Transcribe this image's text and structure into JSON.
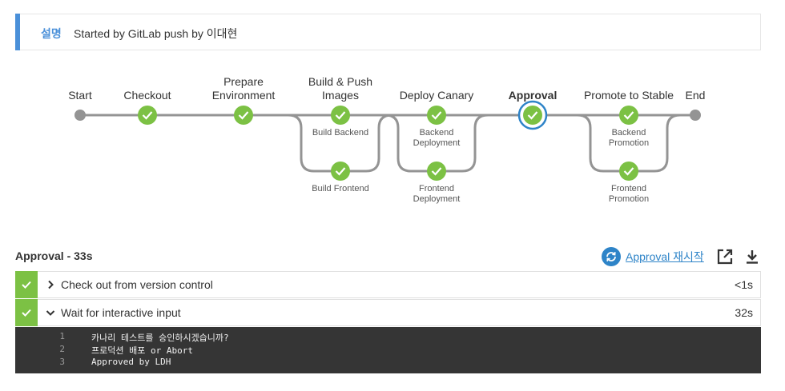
{
  "description": {
    "label": "설명",
    "text": "Started by GitLab push by 이대현"
  },
  "pipeline": {
    "stages": [
      {
        "id": "start",
        "title_lines": [
          "Start"
        ],
        "status": "endpoint"
      },
      {
        "id": "checkout",
        "title_lines": [
          "Checkout"
        ],
        "status": "success"
      },
      {
        "id": "prepare",
        "title_lines": [
          "Prepare",
          "Environment"
        ],
        "status": "success"
      },
      {
        "id": "build",
        "title_lines": [
          "Build & Push",
          "Images"
        ],
        "status": "success",
        "branches": [
          {
            "label_lines": [
              "Build Backend"
            ]
          },
          {
            "label_lines": [
              "Build Frontend"
            ]
          }
        ]
      },
      {
        "id": "deploy",
        "title_lines": [
          "Deploy Canary"
        ],
        "status": "success",
        "branches": [
          {
            "label_lines": [
              "Backend",
              "Deployment"
            ]
          },
          {
            "label_lines": [
              "Frontend",
              "Deployment"
            ]
          }
        ]
      },
      {
        "id": "approval",
        "title_lines": [
          "Approval"
        ],
        "status": "success",
        "selected": true
      },
      {
        "id": "promote",
        "title_lines": [
          "Promote to Stable"
        ],
        "status": "success",
        "branches": [
          {
            "label_lines": [
              "Backend",
              "Promotion"
            ]
          },
          {
            "label_lines": [
              "Frontend",
              "Promotion"
            ]
          }
        ]
      },
      {
        "id": "end",
        "title_lines": [
          "End"
        ],
        "status": "endpoint"
      }
    ]
  },
  "details": {
    "header": "Approval - 33s",
    "restart_label": "Approval 재시작",
    "open_icon": "external-link-icon",
    "download_icon": "download-icon",
    "steps": [
      {
        "label": "Check out from version control",
        "time": "<1s",
        "expanded": false
      },
      {
        "label": "Wait for interactive input",
        "time": "32s",
        "expanded": true
      }
    ],
    "console_lines": [
      {
        "num": "1",
        "text": "카나리 테스트를 승인하시겠습니까?"
      },
      {
        "num": "2",
        "text": "프로덕션 배포 or Abort"
      },
      {
        "num": "3",
        "text": "Approved by LDH"
      }
    ]
  },
  "colors": {
    "success": "#7cc144",
    "accent": "#4a90d9",
    "link": "#2e84c8",
    "console_bg": "#353535",
    "line": "#949494"
  }
}
